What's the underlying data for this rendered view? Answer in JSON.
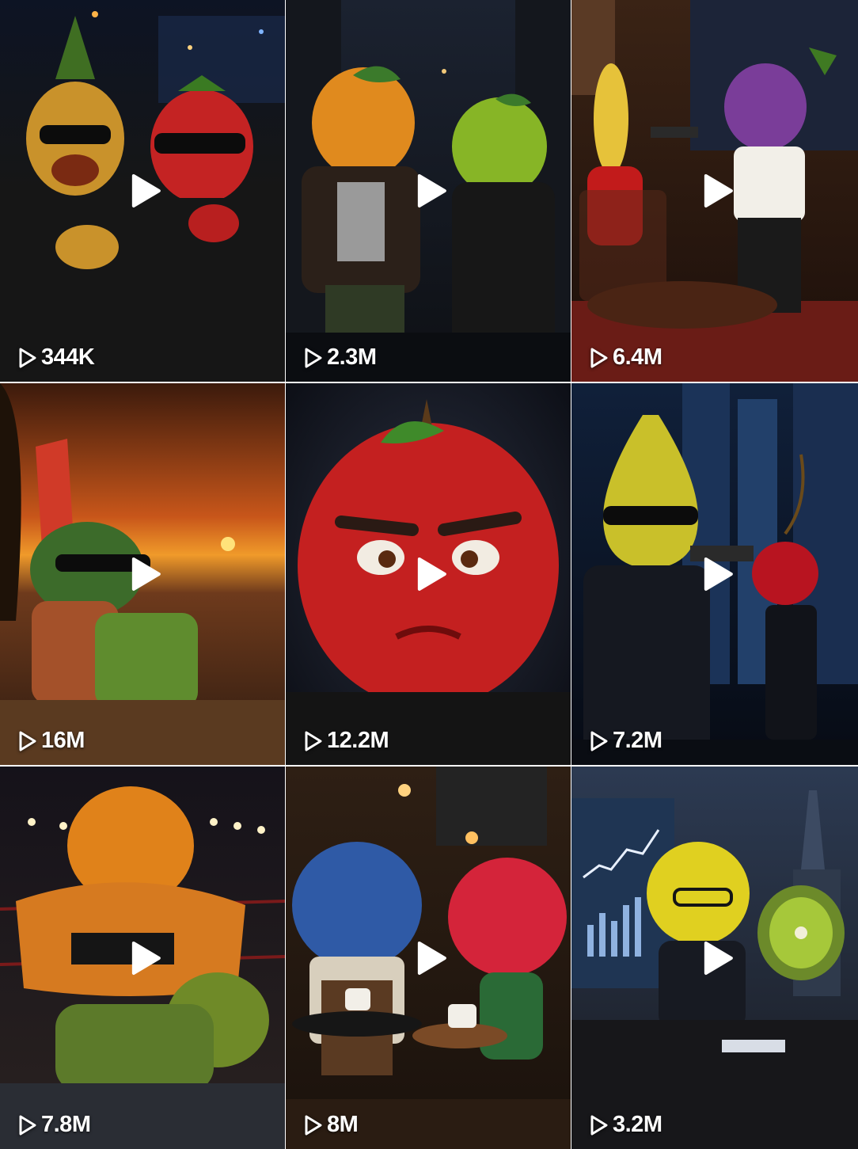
{
  "grid": {
    "videos": [
      {
        "subject": "pineapple and strawberry in sunglasses driving a car at night",
        "views": "344K"
      },
      {
        "subject": "orange and green apple in leather jackets in a rainy alley",
        "views": "2.3M"
      },
      {
        "subject": "banana in red dress and grape holding a gun in a lounge",
        "views": "6.4M"
      },
      {
        "subject": "watermelon in sunglasses on a beach chair at sunset",
        "views": "16M"
      },
      {
        "subject": "angry red apple close-up",
        "views": "12.2M"
      },
      {
        "subject": "pear in suit pointing a gun at a cherry in an office",
        "views": "7.2M"
      },
      {
        "subject": "muscular orange wrestler over a lime in a ring",
        "views": "7.8M"
      },
      {
        "subject": "blueberry barista serving coffee to a raspberry in a cafe",
        "views": "8M"
      },
      {
        "subject": "lemon presenting a chart to a kiwi in a boardroom",
        "views": "3.2M"
      }
    ]
  },
  "icons": {
    "play": "play-icon",
    "views": "play-outline-icon"
  }
}
